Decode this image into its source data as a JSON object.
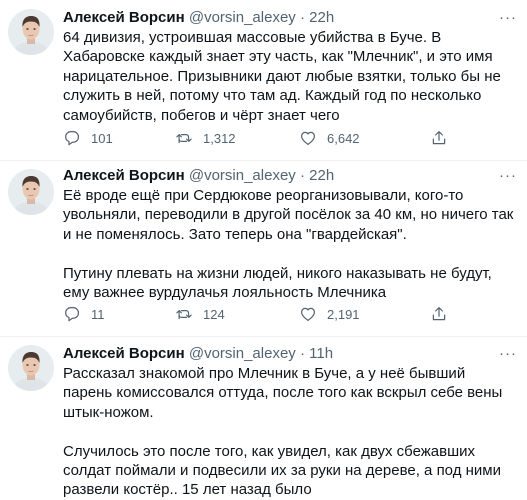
{
  "tweets": [
    {
      "name": "Алексей Ворсин",
      "handle": "@vorsin_alexey",
      "separator": "·",
      "time": "22h",
      "more": "···",
      "paragraphs": [
        "64 дивизия, устроившая массовые убийства в Буче. В Хабаровске каждый знает эту часть, как \"Млечник\", и это имя нарицательное. Призывники дают любые взятки, только бы не служить в ней, потому что там ад. Каждый год по несколько самоубийств, побегов и чёрт знает чего"
      ],
      "replies": "101",
      "retweets": "1,312",
      "likes": "6,642"
    },
    {
      "name": "Алексей Ворсин",
      "handle": "@vorsin_alexey",
      "separator": "·",
      "time": "22h",
      "more": "···",
      "paragraphs": [
        "Её вроде ещё при Сердюкове реорганизовывали, кого-то увольняли, переводили в другой посёлок за 40 км, но ничего так и не поменялось. Зато теперь она \"гвардейская\".",
        "Путину плевать на жизни людей, никого наказывать не будут, ему важнее вурдулачья лояльность Млечника"
      ],
      "replies": "11",
      "retweets": "124",
      "likes": "2,191"
    },
    {
      "name": "Алексей Ворсин",
      "handle": "@vorsin_alexey",
      "separator": "·",
      "time": "11h",
      "more": "···",
      "paragraphs": [
        "Рассказал знакомой про Млечник в Буче, а у неё бывший парень комиссовался оттуда, после того как вскрыл себе вены штык-ножом.",
        "Случилось это после того, как увидел, как двух сбежавших солдат поймали и подвесили их за руки на дереве, а под ними развели костёр.. 15 лет назад было"
      ]
    }
  ],
  "colors": {
    "text": "#0f1419",
    "secondary": "#536471",
    "divider": "#eff3f4"
  }
}
